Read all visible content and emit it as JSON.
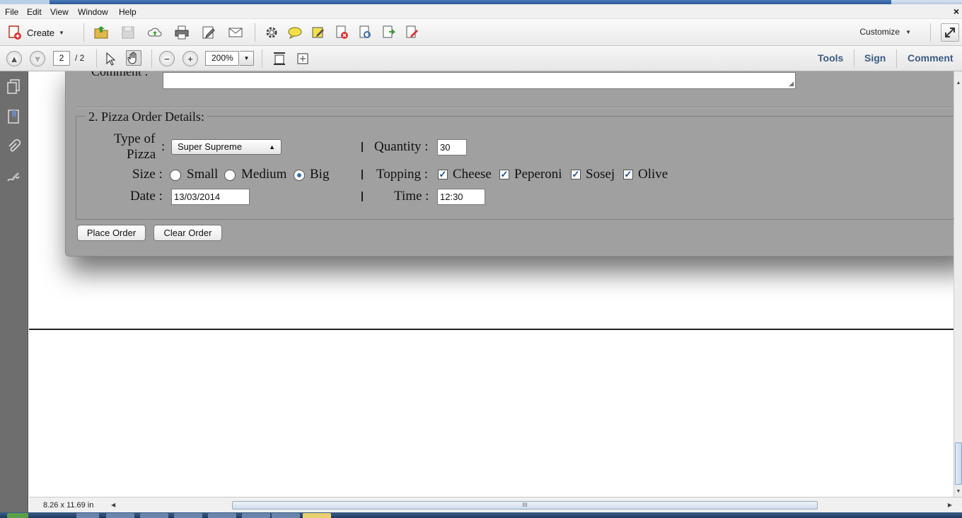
{
  "menubar": {
    "items": [
      "File",
      "Edit",
      "View",
      "Window",
      "Help"
    ],
    "close_glyph": "×"
  },
  "toolbar": {
    "create_label": "Create",
    "customize_label": "Customize",
    "icons": [
      "open-folder-icon",
      "save-icon",
      "upload-cloud-icon",
      "print-icon",
      "edit-icon",
      "email-icon",
      "settings-gear-icon",
      "comment-bubble-icon",
      "highlight-icon",
      "delete-page-icon",
      "scan-icon",
      "export-icon",
      "extract-icon"
    ]
  },
  "navbar": {
    "page_current": "2",
    "page_total": "/ 2",
    "zoom": "200%",
    "tabs": {
      "tools": "Tools",
      "sign": "Sign",
      "comment": "Comment"
    }
  },
  "form": {
    "comment_label": "Comment :",
    "legend": "2. Pizza Order Details:",
    "type_label_1": "Type of",
    "type_label_2": "Pizza",
    "colon": ":",
    "pizza_type_value": "Super Supreme",
    "quantity_label": "Quantity :",
    "quantity_value": "30",
    "size_label": "Size :",
    "size_options": {
      "small": "Small",
      "medium": "Medium",
      "big": "Big"
    },
    "size_selected": "Big",
    "topping_label": "Topping :",
    "toppings": {
      "cheese": "Cheese",
      "peperoni": "Peperoni",
      "sosej": "Sosej",
      "olive": "Olive"
    },
    "toppings_checked": [
      "Cheese",
      "Peperoni",
      "Sosej",
      "Olive"
    ],
    "date_label": "Date :",
    "date_value": "13/03/2014",
    "time_label": "Time :",
    "time_value": "12:30",
    "place_order_label": "Place Order",
    "clear_order_label": "Clear Order"
  },
  "statusbar": {
    "page_size": "8.26 x 11.69 in",
    "thumb_grip": "III"
  },
  "colors": {
    "form_bg": "#a0a0a0",
    "nav_tab_text": "#3b5a82",
    "side_panel": "#6e6e6e"
  }
}
